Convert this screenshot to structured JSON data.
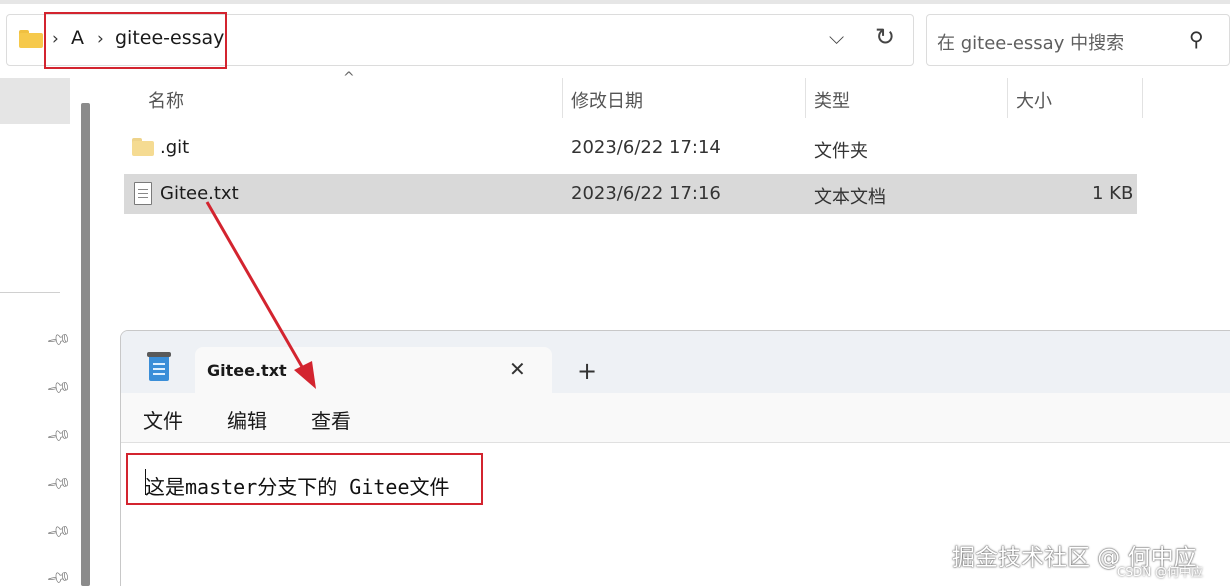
{
  "explorer": {
    "breadcrumb": [
      "A",
      "gitee-essay"
    ],
    "search_placeholder": "在 gitee-essay 中搜索",
    "columns": {
      "name": "名称",
      "modified": "修改日期",
      "type": "类型",
      "size": "大小"
    },
    "files": [
      {
        "name": ".git",
        "modified": "2023/6/22 17:14",
        "type": "文件夹",
        "size": "",
        "icon": "folder-icon"
      },
      {
        "name": "Gitee.txt",
        "modified": "2023/6/22 17:16",
        "type": "文本文档",
        "size": "1 KB",
        "icon": "text-file-icon"
      }
    ]
  },
  "notepad": {
    "tab_title": "Gitee.txt",
    "menu": [
      "文件",
      "编辑",
      "查看"
    ],
    "content": "这是master分支下的 Gitee文件"
  },
  "watermark": {
    "main": "掘金技术社区 @ 何中应",
    "small": "CSDN @何中应"
  },
  "colors": {
    "highlight": "#d3242f",
    "selection": "#d9d9d9"
  }
}
